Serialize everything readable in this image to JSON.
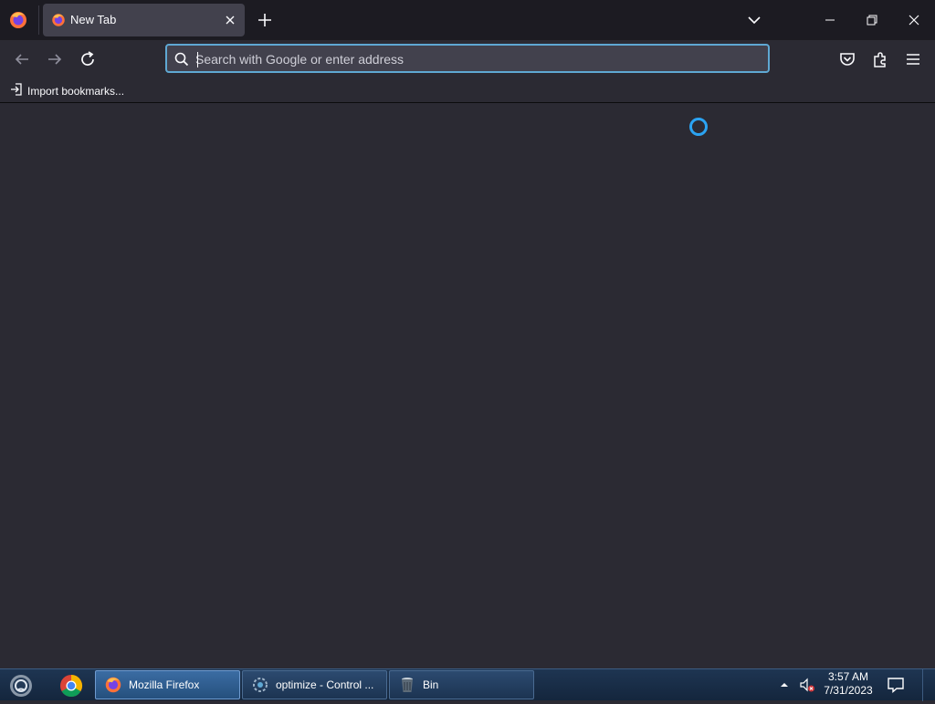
{
  "browser": {
    "tab": {
      "title": "New Tab"
    },
    "urlbar": {
      "placeholder": "Search with Google or enter address",
      "value": ""
    },
    "bookmarks": {
      "import_label": "Import bookmarks..."
    },
    "colors": {
      "accent": "#5fa8d3",
      "spinner": "#2ba3f2",
      "chrome_bg": "#1c1b22",
      "content_bg": "#2b2a33"
    }
  },
  "taskbar": {
    "items": [
      {
        "label": "Mozilla Firefox",
        "icon": "firefox-icon",
        "active": true
      },
      {
        "label": "optimize - Control ...",
        "icon": "control-panel-icon",
        "active": false
      },
      {
        "label": "Bin",
        "icon": "recycle-bin-icon",
        "active": false
      }
    ],
    "clock": {
      "time": "3:57 AM",
      "date": "7/31/2023"
    }
  }
}
